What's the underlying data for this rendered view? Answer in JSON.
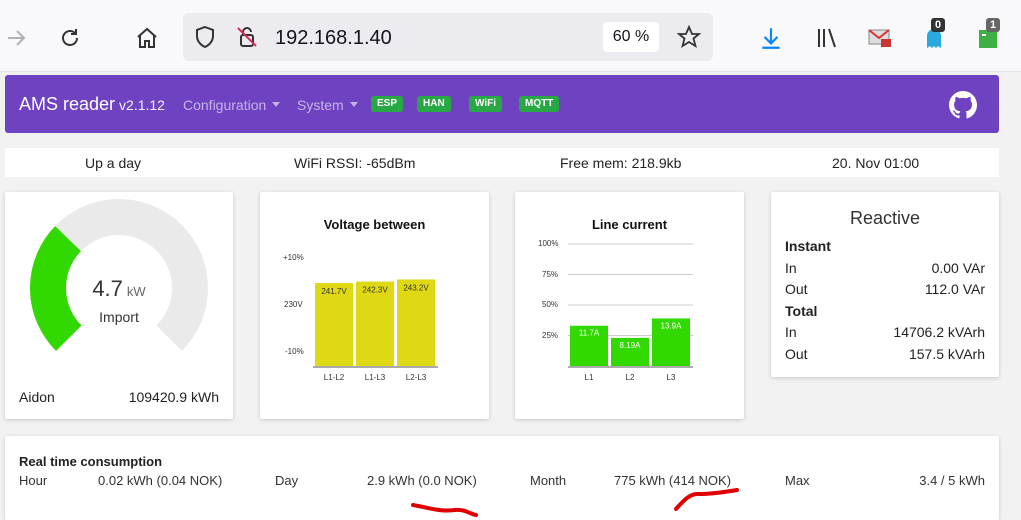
{
  "browser": {
    "url": "192.168.1.40",
    "zoom": "60 %",
    "ext_badge_1": "0",
    "ext_badge_2": "1"
  },
  "navbar": {
    "brand": "AMS reader",
    "version": "v2.1.12",
    "configuration": "Configuration",
    "system": "System",
    "pills": [
      "ESP",
      "HAN",
      "WiFi",
      "MQTT"
    ]
  },
  "status": {
    "uptime": "Up a day",
    "wifi": "WiFi RSSI: -65dBm",
    "mem": "Free mem: 218.9kb",
    "datetime": "20. Nov 01:00"
  },
  "gauge": {
    "value": "4.7",
    "unit": "kW",
    "label": "Import",
    "fill_fraction": 0.33,
    "meter": "Aidon",
    "meter_reading": "109420.9 kWh"
  },
  "voltage": {
    "title": "Voltage between",
    "ticks": [
      "+10%",
      "230V",
      "-10%"
    ],
    "chart_data": {
      "type": "bar",
      "categories": [
        "L1-L2",
        "L1-L3",
        "L2-L3"
      ],
      "values": [
        241.7,
        242.3,
        243.2
      ],
      "labels": [
        "241.7V",
        "242.3V",
        "243.2V"
      ],
      "ylim": [
        207,
        253
      ]
    }
  },
  "current": {
    "title": "Line current",
    "ticks": [
      "100%",
      "75%",
      "50%",
      "25%"
    ],
    "chart_data": {
      "type": "bar",
      "categories": [
        "L1",
        "L2",
        "L3"
      ],
      "values": [
        11.7,
        8.19,
        13.9
      ],
      "labels": [
        "11.7A",
        "8.19A",
        "13.9A"
      ],
      "percent_of_max": [
        33,
        23,
        39
      ],
      "ylim": [
        0,
        100
      ]
    }
  },
  "reactive": {
    "title": "Reactive",
    "instant": "Instant",
    "in_label": "In",
    "out_label": "Out",
    "instant_in": "0.00 VAr",
    "instant_out": "112.0 VAr",
    "total": "Total",
    "total_in": "14706.2 kVArh",
    "total_out": "157.5 kVArh"
  },
  "realtime": {
    "title": "Real time consumption",
    "hour_label": "Hour",
    "hour_value": "0.02 kWh (0.04 NOK)",
    "day_label": "Day",
    "day_value": "2.9 kWh (0.0 NOK)",
    "month_label": "Month",
    "month_value": "775 kWh (414 NOK)",
    "max_label": "Max",
    "max_value": "3.4 / 5 kWh"
  },
  "colors": {
    "navbar": "#6f42c1",
    "pill": "#28a745",
    "gauge_fill": "#32d900",
    "gauge_track": "#eaeaea",
    "voltage_bar": "#dfd814",
    "current_bar": "#32d900",
    "annotation": "#e00000"
  }
}
